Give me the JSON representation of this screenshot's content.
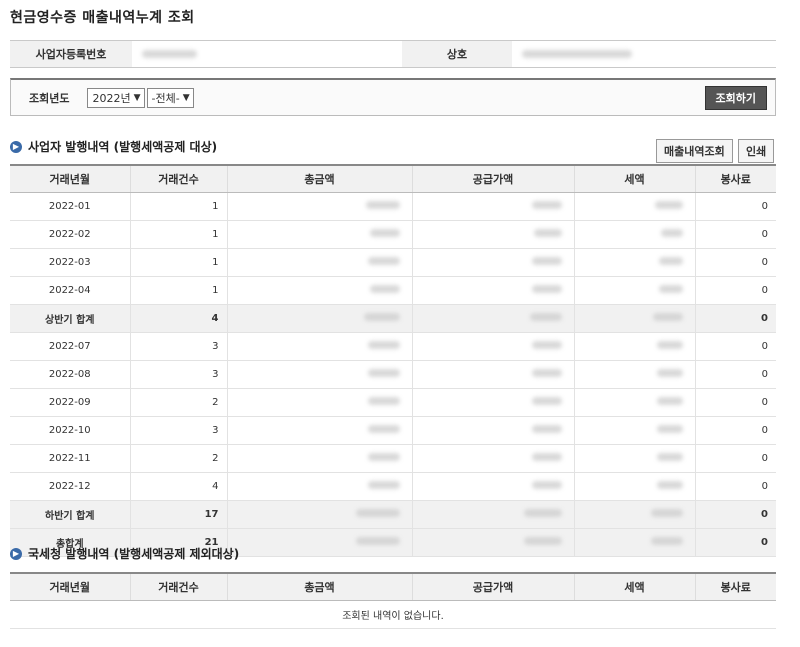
{
  "page": {
    "title": "현금영수증 매출내역누계 조회"
  },
  "info": {
    "biz_no_label": "사업자등록번호",
    "name_label": "상호"
  },
  "search": {
    "label": "조회년도",
    "year": "2022년",
    "period": "-전체-",
    "button": "조회하기"
  },
  "section1": {
    "title": "사업자 발행내역 (발행세액공제 대상)",
    "btn_sales": "매출내역조회",
    "btn_print": "인쇄",
    "headers": [
      "거래년월",
      "거래건수",
      "총금액",
      "공급가액",
      "세액",
      "봉사료"
    ],
    "rows": [
      {
        "period": "2022-01",
        "count": "1",
        "fee": "0",
        "subtotal": false
      },
      {
        "period": "2022-02",
        "count": "1",
        "fee": "0",
        "subtotal": false
      },
      {
        "period": "2022-03",
        "count": "1",
        "fee": "0",
        "subtotal": false
      },
      {
        "period": "2022-04",
        "count": "1",
        "fee": "0",
        "subtotal": false
      },
      {
        "period": "상반기 합계",
        "count": "4",
        "fee": "0",
        "subtotal": true
      },
      {
        "period": "2022-07",
        "count": "3",
        "fee": "0",
        "subtotal": false
      },
      {
        "period": "2022-08",
        "count": "3",
        "fee": "0",
        "subtotal": false
      },
      {
        "period": "2022-09",
        "count": "2",
        "fee": "0",
        "subtotal": false
      },
      {
        "period": "2022-10",
        "count": "3",
        "fee": "0",
        "subtotal": false
      },
      {
        "period": "2022-11",
        "count": "2",
        "fee": "0",
        "subtotal": false
      },
      {
        "period": "2022-12",
        "count": "4",
        "fee": "0",
        "subtotal": false
      },
      {
        "period": "하반기 합계",
        "count": "17",
        "fee": "0",
        "subtotal": true
      },
      {
        "period": "총합계",
        "count": "21",
        "fee": "0",
        "subtotal": true
      }
    ]
  },
  "section2": {
    "title": "국세청 발행내역 (발행세액공제 제외대상)",
    "headers": [
      "거래년월",
      "거래건수",
      "총금액",
      "공급가액",
      "세액",
      "봉사료"
    ],
    "empty": "조회된 내역이 없습니다."
  }
}
